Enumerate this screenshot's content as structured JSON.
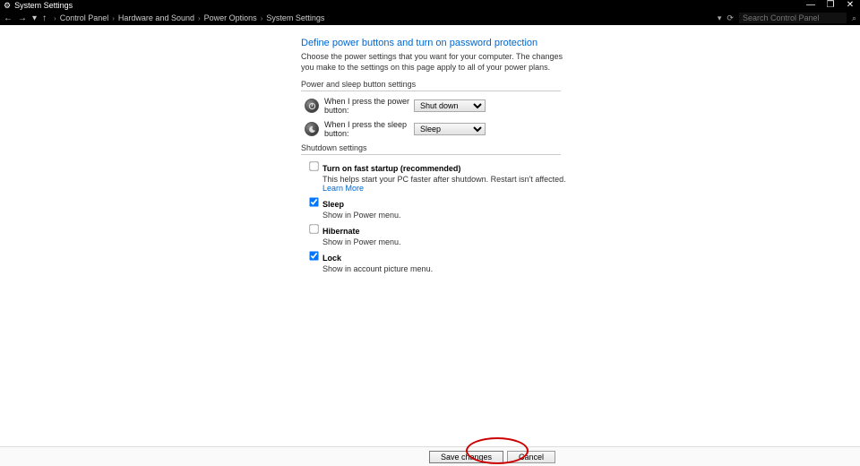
{
  "window": {
    "title": "System Settings",
    "min": "—",
    "max": "❐",
    "close": "✕"
  },
  "nav": {
    "back": "←",
    "forward": "→",
    "recent": "▾",
    "up": "↑",
    "crumb_guard": "›",
    "dd_caret": "▾",
    "refresh": "⟳",
    "search_placeholder": "Search Control Panel",
    "search_icon": "⌕"
  },
  "breadcrumbs": [
    "Control Panel",
    "Hardware and Sound",
    "Power Options",
    "System Settings"
  ],
  "page": {
    "heading": "Define power buttons and turn on password protection",
    "description": "Choose the power settings that you want for your computer. The changes you make to the settings on this page apply to all of your power plans.",
    "section_buttons": "Power and sleep button settings",
    "power_label": "When I press the power button:",
    "power_value": "Shut down",
    "sleep_label": "When I press the sleep button:",
    "sleep_value": "Sleep",
    "section_shutdown": "Shutdown settings",
    "fast_startup_label": "Turn on fast startup (recommended)",
    "fast_startup_help": "This helps start your PC faster after shutdown. Restart isn't affected. ",
    "learn_more": "Learn More",
    "sleep_opt_label": "Sleep",
    "sleep_opt_help": "Show in Power menu.",
    "hibernate_label": "Hibernate",
    "hibernate_help": "Show in Power menu.",
    "lock_label": "Lock",
    "lock_help": "Show in account picture menu."
  },
  "footer": {
    "save": "Save changes",
    "cancel": "Cancel"
  }
}
